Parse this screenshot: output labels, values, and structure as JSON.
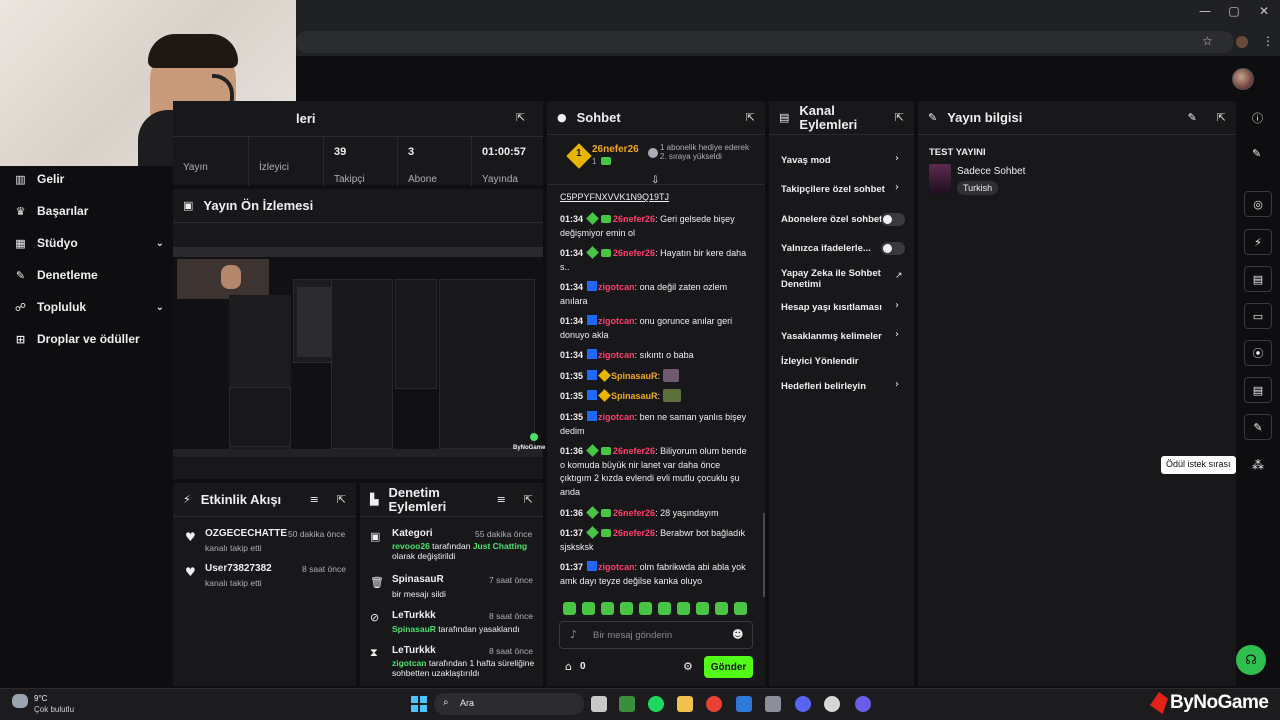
{
  "browser": {
    "window_controls": [
      "—",
      "▢",
      "✕"
    ]
  },
  "nav": {
    "items": [
      {
        "label": "Gelir",
        "icon": "chart-icon"
      },
      {
        "label": "Başarılar",
        "icon": "trophy-icon"
      },
      {
        "label": "Stüdyo",
        "icon": "studio-icon",
        "expand": true
      },
      {
        "label": "Denetleme",
        "icon": "wrench-icon"
      },
      {
        "label": "Topluluk",
        "icon": "people-icon",
        "expand": true
      },
      {
        "label": "Droplar ve ödüller",
        "icon": "gift-icon"
      }
    ]
  },
  "stats": {
    "title_partial": "leri",
    "items": [
      {
        "value": "",
        "label": "Yayın"
      },
      {
        "value": "",
        "label": "İzleyici"
      },
      {
        "value": "39",
        "label": "Takipçi"
      },
      {
        "value": "3",
        "label": "Abone"
      },
      {
        "value": "01:00:57",
        "label": "Yayında"
      }
    ]
  },
  "preview": {
    "title": "Yayın Ön İzlemesi",
    "watermark": "ByNoGame"
  },
  "activity": {
    "title": "Etkinlik Akışı",
    "items": [
      {
        "name": "OZGECECHATTE",
        "sub": "kanalı takip etti",
        "time": "50 dakika önce"
      },
      {
        "name": "User73827382",
        "sub": "kanalı takip etti",
        "time": "8 saat önce"
      }
    ]
  },
  "modlog": {
    "title": "Denetim Eylemleri",
    "items": [
      {
        "name": "Kategori",
        "time": "55 dakika önce",
        "actor": "revooo26",
        "mid": " tarafından ",
        "target": "Just Chatting",
        "tail": " olarak değiştirildi"
      },
      {
        "name": "SpinasauR",
        "time": "7 saat önce",
        "line": "bir mesajı sildi"
      },
      {
        "name": "LeTurkkk",
        "time": "8 saat önce",
        "actor": "SpinasauR",
        "tail": " tarafından yasaklandı"
      },
      {
        "name": "LeTurkkk",
        "time": "8 saat önce",
        "actor": "zigotcan",
        "tail": " tarafından 1 hafta süreliğine sohbetten uzaklaştırıldı"
      }
    ]
  },
  "chat": {
    "title": "Sohbet",
    "pinned_user": "26nefer26",
    "pinned_rank": "1",
    "pinned_count": "1",
    "gift_text": "1 abonelik hediye ederek 2. sıraya yükseldi",
    "code_line": "C5PPYFNXVVK1N9Q19TJ",
    "messages": [
      {
        "time": "01:34",
        "user": "26nefer26",
        "color": "pink",
        "badges": "g-bot",
        "text": "Geri gelsede bişey değişmiyor emin ol"
      },
      {
        "time": "01:34",
        "user": "26nefer26",
        "color": "pink",
        "badges": "g-bot",
        "text": "Hayatın bir kere daha s.."
      },
      {
        "time": "01:34",
        "user": "zigotcan",
        "color": "pink",
        "badges": "b",
        "text": "ona değil zaten ozlem anılara"
      },
      {
        "time": "01:34",
        "user": "zigotcan",
        "color": "pink",
        "badges": "b",
        "text": "onu gorunce anılar geri donuyo akla"
      },
      {
        "time": "01:34",
        "user": "zigotcan",
        "color": "pink",
        "badges": "b",
        "text": "sıkıntı o baba"
      },
      {
        "time": "01:35",
        "user": "SpinasauR",
        "color": "gold",
        "badges": "b-y",
        "text": "",
        "emote": "1"
      },
      {
        "time": "01:35",
        "user": "SpinasauR",
        "color": "gold",
        "badges": "b-y",
        "text": "",
        "emote": "2"
      },
      {
        "time": "01:35",
        "user": "zigotcan",
        "color": "pink",
        "badges": "b",
        "text": "ben ne saman yanlıs bişey dedim"
      },
      {
        "time": "01:36",
        "user": "26nefer26",
        "color": "pink",
        "badges": "g-bot",
        "text": "Biliyorum olum bende o komuda büyük nir lanet var daha önce çıktıgım 2 kızda evlendi evli mutlu çocuklu şu anda"
      },
      {
        "time": "01:36",
        "user": "26nefer26",
        "color": "pink",
        "badges": "g-bot",
        "text": "28 yaşındayım"
      },
      {
        "time": "01:37",
        "user": "26nefer26",
        "color": "pink",
        "badges": "g-bot",
        "text": "Berabwr bot bağladık sjsksksk"
      },
      {
        "time": "01:37",
        "user": "zigotcan",
        "color": "pink",
        "badges": "b",
        "text": "olm fabrikwda abi abla yok amk dayı teyze değilse kanka oluyo"
      }
    ],
    "input_placeholder": "Bir mesaj gönderin",
    "points": "0",
    "send_label": "Gönder"
  },
  "channel_actions": {
    "title": "Kanal Eylemleri",
    "items": [
      {
        "label": "Yavaş mod",
        "kind": "chevron"
      },
      {
        "label": "Takipçilere özel sohbet",
        "kind": "chevron"
      },
      {
        "label": "Abonelere özel sohbet",
        "kind": "toggle"
      },
      {
        "label": "Yalnızca ifadelerle...",
        "kind": "toggle"
      },
      {
        "label": "Yapay Zeka ile Sohbet Denetimi",
        "kind": "external"
      },
      {
        "label": "Hesap yaşı kısıtlaması",
        "kind": "chevron"
      },
      {
        "label": "Yasaklanmış kelimeler",
        "kind": "chevron"
      },
      {
        "label": "İzleyici Yönlendir",
        "kind": "none"
      },
      {
        "label": "Hedefleri belirleyin",
        "kind": "chevron"
      }
    ]
  },
  "stream_info": {
    "title": "Yayın bilgisi",
    "stream_title": "TEST YAYINI",
    "category": "Sadece Sohbet",
    "language": "Turkish"
  },
  "rail": {
    "tooltip": "Ödül istek sırası"
  },
  "taskbar": {
    "weather_temp": "9°C",
    "weather_desc": "Çok bulutlu",
    "search_label": "Ara",
    "brand": "ByNoGame"
  },
  "colors": {
    "accent_green": "#49e36b",
    "pink_user": "#ff3e6c",
    "gold_user": "#f0a71e",
    "panel": "#18181b",
    "bg": "#0e0e10"
  }
}
